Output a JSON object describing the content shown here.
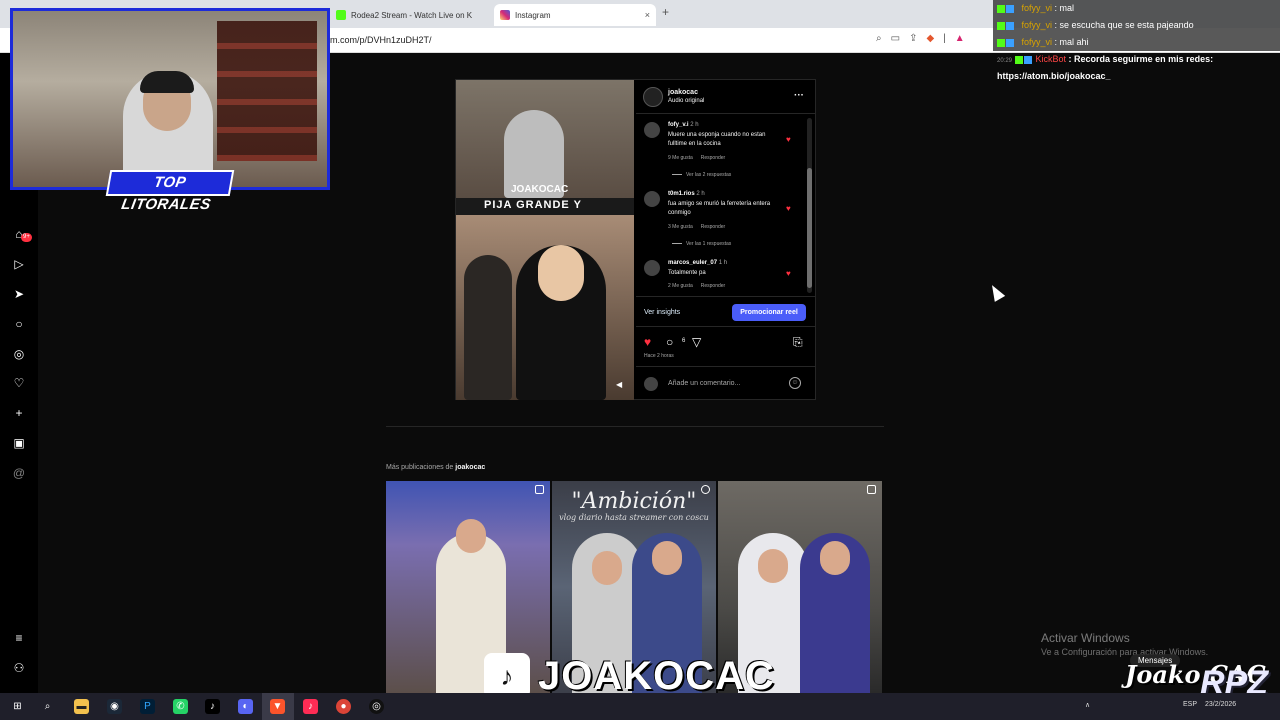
{
  "browser": {
    "tabs": [
      {
        "title": "Rodea2 Stream - Watch Live on K",
        "active": false
      },
      {
        "title": "Instagram",
        "active": true
      }
    ],
    "new_tab": "+",
    "close_glyph": "×",
    "url": "m.com/p/DVHn1zuDH2T/"
  },
  "stream_overlay": {
    "badge": "TOP LITORALES"
  },
  "chat": {
    "messages": [
      {
        "user": "fofyy_vi",
        "text": "mal",
        "bot": false,
        "time": ""
      },
      {
        "user": "fofyy_vi",
        "text": "se escucha que se esta pajeando",
        "bot": false,
        "time": ""
      },
      {
        "user": "fofyy_vi",
        "text": "mal ahi",
        "bot": false,
        "time": ""
      },
      {
        "user": "KickBot",
        "text": "Recorda seguirme en mis redes:",
        "bot": true,
        "time": "20:29"
      }
    ],
    "bot_link": "https://atom.bio/joakocac_"
  },
  "post": {
    "author": "joakocac",
    "audio": "Audio original",
    "media_tiktok": "JOAKOCAC",
    "media_caption": "PIJA GRANDE Y",
    "comments": [
      {
        "user": "fofy_v.i",
        "time": "2 h",
        "text": "Muere una esponja cuando no estan fulltime en la cocina",
        "likes": "9 Me gusta",
        "reply": "Responder",
        "replies": "Ver las 2 respuestas"
      },
      {
        "user": "t0m1.rios",
        "time": "2 h",
        "text": "fua amigo se murió la ferretería entera conmigo",
        "likes": "3 Me gusta",
        "reply": "Responder",
        "replies": "Ver las 1 respuestas"
      },
      {
        "user": "marcos_euler_07",
        "time": "1 h",
        "text": "Totalmente pa",
        "likes": "2 Me gusta",
        "reply": "Responder",
        "replies": ""
      }
    ],
    "insights": "Ver insights",
    "promote": "Promocionar reel",
    "comment_count": "6",
    "time_ago": "Hace 2 horas",
    "add_comment_placeholder": "Añade un comentario..."
  },
  "more_posts": {
    "label": "Más publicaciones de",
    "user": "joakocac",
    "item2_title": "\"Ambición\"",
    "item2_subtitle": "vlog diario hasta streamer con coscu"
  },
  "tiktok_overlay": {
    "name": "JOAKOCAC"
  },
  "nav": {
    "notifications_badge": "9+"
  },
  "windows": {
    "watermark_title": "Activar Windows",
    "watermark_sub": "Ve a Configuración para activar Windows.",
    "messages_chip": "Mensajes",
    "tray_lang": "ESP",
    "tray_date": "23/2/2026"
  },
  "brand": {
    "logo1": "Joako CAC",
    "logo2": "RPZ"
  },
  "colors": {
    "accent_blue": "#4a5df9",
    "like_red": "#ff3040",
    "kick_green": "#53fc18",
    "stream_blue": "#1d2bd9"
  }
}
